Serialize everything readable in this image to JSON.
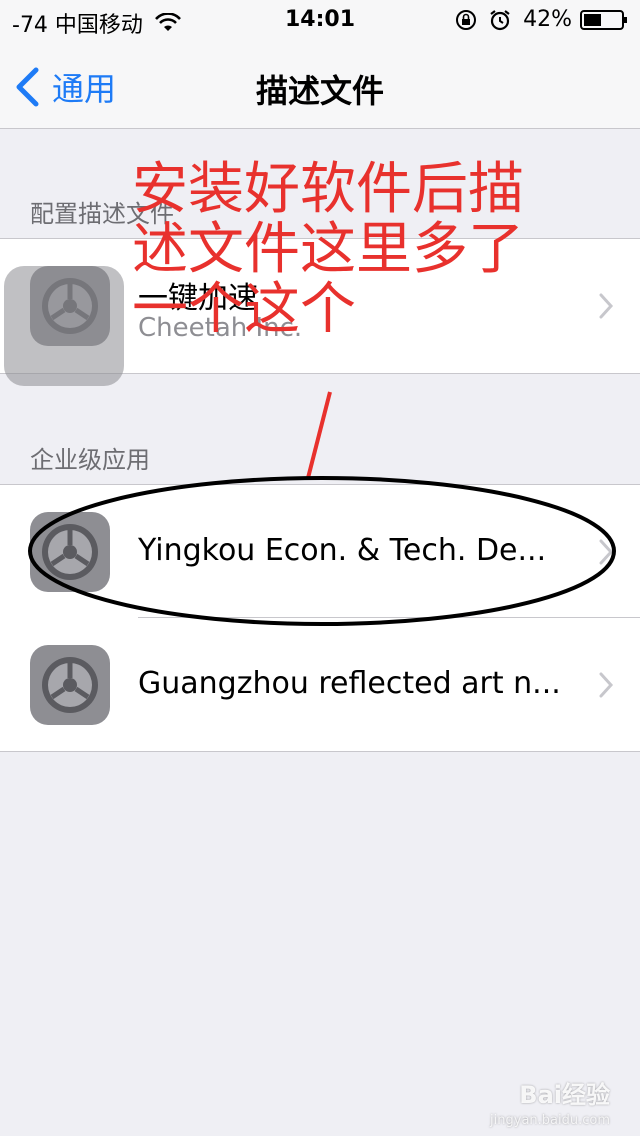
{
  "status_bar": {
    "carrier": "-74 中国移动",
    "time": "14:01",
    "battery": "42%"
  },
  "nav": {
    "back_label": "通用",
    "title": "描述文件"
  },
  "sections": {
    "config_profiles": {
      "header": "配置描述文件",
      "items": [
        {
          "title": "一键加速",
          "subtitle": "Cheetah Inc."
        }
      ]
    },
    "enterprise_apps": {
      "header": "企业级应用",
      "items": [
        {
          "title": "Yingkou Econ. & Tech. De..."
        },
        {
          "title": "Guangzhou reflected art n..."
        }
      ]
    }
  },
  "annotation": {
    "text": "安装好软件后描\n述文件这里多了\n一个这个",
    "color": "#e8312d"
  },
  "watermark": {
    "text": "Bai经验",
    "sub": "jingyan.baidu.com"
  },
  "icons": {
    "settings": "gear-icon",
    "chevron": "chevron-right-icon",
    "back": "chevron-left-icon"
  },
  "colors": {
    "accent": "#1e7bf6",
    "background": "#efeff4"
  }
}
